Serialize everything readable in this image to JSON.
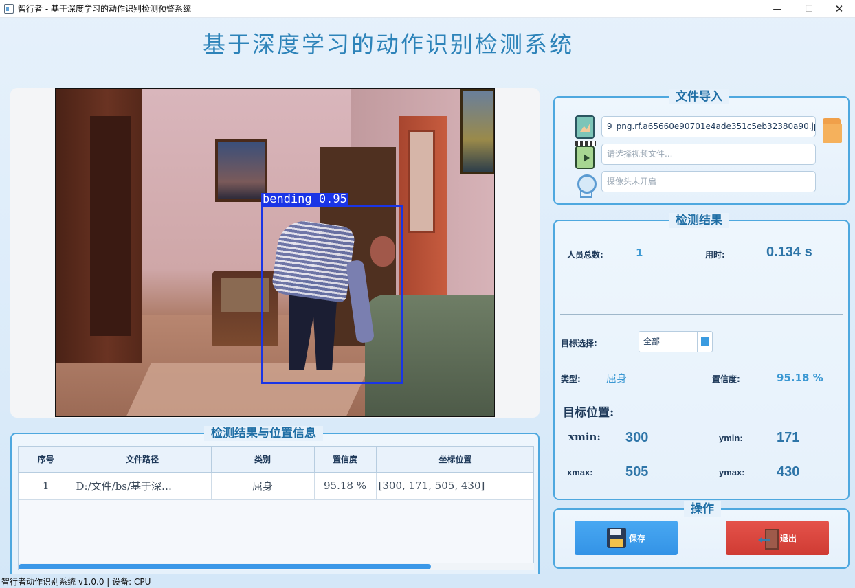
{
  "window": {
    "title": "智行者 - 基于深度学习的动作识别检测预警系统",
    "min": "—",
    "max": "☐",
    "close": "✕"
  },
  "app_title": "基于深度学习的动作识别检测系统",
  "viewer": {
    "detection_label": "bending 0.95"
  },
  "file_import": {
    "title": "文件导入",
    "image_path": "9_png.rf.a65660e90701e4ade351c5eb32380a90.jpg",
    "video_placeholder": "请选择视频文件...",
    "camera_placeholder": "摄像头未开启",
    "icons": [
      "image-icon",
      "video-icon",
      "camera-icon",
      "folder-icon"
    ]
  },
  "results": {
    "title": "检测结果",
    "total_label": "人员总数:",
    "total_value": "1",
    "time_label": "用时:",
    "time_value": "0.134 s",
    "target_select_label": "目标选择:",
    "target_select_value": "全部",
    "type_label": "类型:",
    "type_value": "屈身",
    "confidence_label": "置信度:",
    "confidence_value": "95.18 %",
    "position_title": "目标位置:",
    "xmin_label": "xmin:",
    "xmin_value": "300",
    "ymin_label": "ymin:",
    "ymin_value": "171",
    "xmax_label": "xmax:",
    "xmax_value": "505",
    "ymax_label": "ymax:",
    "ymax_value": "430"
  },
  "operations": {
    "title": "操作",
    "save_label": "保存",
    "exit_label": "退出"
  },
  "table": {
    "title": "检测结果与位置信息",
    "columns": [
      "序号",
      "文件路径",
      "类别",
      "置信度",
      "坐标位置"
    ],
    "rows": [
      [
        "1",
        "D:/文件/bs/基于深…",
        "屈身",
        "95.18 %",
        "[300, 171, 505, 430]"
      ]
    ]
  },
  "status_bar": "智行者动作识别系统 v1.0.0 | 设备: CPU",
  "colors": {
    "accent": "#4ea8df",
    "title_blue": "#2d83b9",
    "save_button": "#3b9cee",
    "exit_button": "#dc463e",
    "bbox": "#1a35e6"
  }
}
